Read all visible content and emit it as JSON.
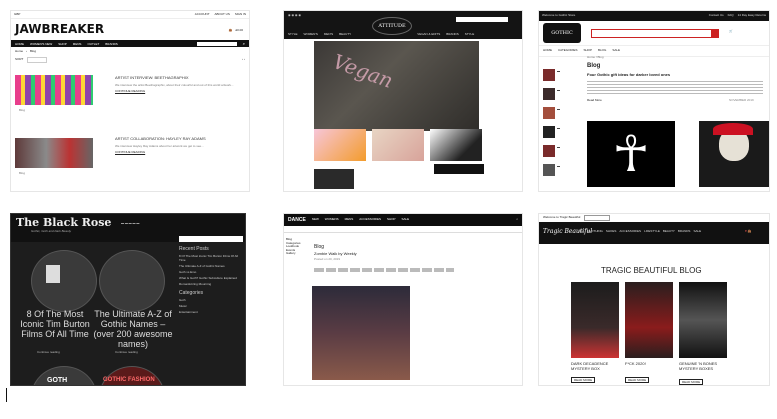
{
  "tiles": {
    "jawbreaker": {
      "brand": "JAWBREAKER",
      "top_left": "GBP",
      "top_right": [
        "ACCOUNT",
        "ABOUT US",
        "SIGN IN"
      ],
      "nav": [
        "HOME",
        "WOMEN'S NEW",
        "SHOP",
        "MENS",
        "OUTLET",
        "BRANDS"
      ],
      "search_placeholder": "SEARCH",
      "basket": "£0.00",
      "breadcrumb": [
        "Home",
        "Blog"
      ],
      "sort_label": "SORT",
      "posts": [
        {
          "title": "ARTIST INTERVIEW: BEETHAGRAPHIX",
          "excerpt": "We interview the artist Beethagraphix, about their colourful and out of this world artwork...",
          "more": "CONTINUE READING",
          "tag": "Blog"
        },
        {
          "title": "ARTIST COLLABORATION: HAYLEY RAY ADAMS",
          "excerpt": "We interview Hayley Ray Adams about her artwork we get to see...",
          "more": "CONTINUE READING",
          "tag": "Blog"
        }
      ]
    },
    "attitude": {
      "logo": "ATTITUDE",
      "nav": [
        "STYLE",
        "WOMEN'S",
        "MEN'S",
        "BEAUTY",
        "VEGAN & EDITS",
        "BRANDS",
        "STYLE"
      ],
      "hero_text": "Vegan"
    },
    "gothic": {
      "logo": "GOTHIC",
      "top_left": "Welcome to Gothic Store",
      "top_right": [
        "Contact Us",
        "FAQ",
        "14 Day Easy Returns"
      ],
      "nav": [
        "HOME",
        "CATEGORIES",
        "SHOP",
        "BLOG",
        "SALE"
      ],
      "breadcrumb": "Home / Blog",
      "heading": "Blog",
      "post_title": "Four Gothic gift ideas for darker loved ones",
      "post_meta": "NOVEMBER 2019",
      "read_more": "Read More"
    },
    "blackrose": {
      "title": "The Black Rose",
      "subtitle": "Gothic, Goth and Dark Beauty",
      "posts": [
        "8 Of The Most Iconic Tim Burton Films Of All Time",
        "The Ultimate A-Z of Gothic Names – (over 200 awesome names)"
      ],
      "bottom": [
        "GOTH",
        "GOTHIC FASHION"
      ],
      "read": "Continue reading",
      "sidebar_recent": "Recent Posts",
      "sidebar_categories": "Categories",
      "sidebar_items": [
        "8 Of The Most Iconic Tim Burton Films Of All Time",
        "The Ultimate A-Z of Gothic Names",
        "Goth vs Emo",
        "What Is Goth? Gothic Subculture Explained",
        "Romanticizing Mourning"
      ],
      "category_items": [
        "Goth",
        "Music",
        "Entertainment"
      ]
    },
    "blackblog": {
      "logo": "DANCE",
      "nav": [
        "NEW",
        "WOMENS",
        "MENS",
        "ACCESSORIES",
        "SHOP",
        "SALE"
      ],
      "sidebar": [
        "Blog",
        "Categories",
        "Lookbook",
        "Events",
        "Gallery"
      ],
      "heading": "Blog",
      "post_title": "Zombie Walk by Weekly",
      "post_meta": "Posted on 20, 2019"
    },
    "tragic": {
      "logo": "Tragic Beautiful",
      "topbar": "Welcome to Tragic Beautiful",
      "heading": "TRAGIC BEAUTIFUL BLOG",
      "nav": [
        "ALL",
        "CLOTHING",
        "SHOES",
        "ACCESSORIES",
        "LIFESTYLE",
        "BEAUTY",
        "BRANDS",
        "SALE"
      ],
      "posts": [
        {
          "title": "DARK DECADENCE MYSTERY BOX",
          "btn": "READ MORE"
        },
        {
          "title": "F*CK 2020!",
          "btn": "READ MORE"
        },
        {
          "title": "GENUINE 'N BONES MYSTERY BOXES",
          "btn": "READ MORE"
        }
      ]
    }
  }
}
